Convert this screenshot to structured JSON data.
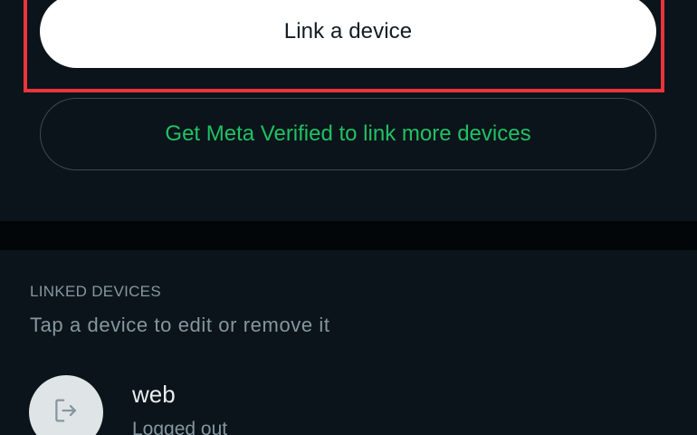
{
  "buttons": {
    "link_device": "Link a device",
    "meta_verified": "Get Meta Verified to link more devices"
  },
  "linked_devices": {
    "header": "LINKED DEVICES",
    "subtitle": "Tap a device to edit or remove it",
    "items": [
      {
        "name": "web",
        "status": "Logged out",
        "icon": "logout-icon"
      }
    ]
  },
  "colors": {
    "background": "#0b141a",
    "accent_green": "#21c063",
    "highlight_red": "#e8343a",
    "primary_button": "#ffffff",
    "muted_text": "#8696a0"
  }
}
